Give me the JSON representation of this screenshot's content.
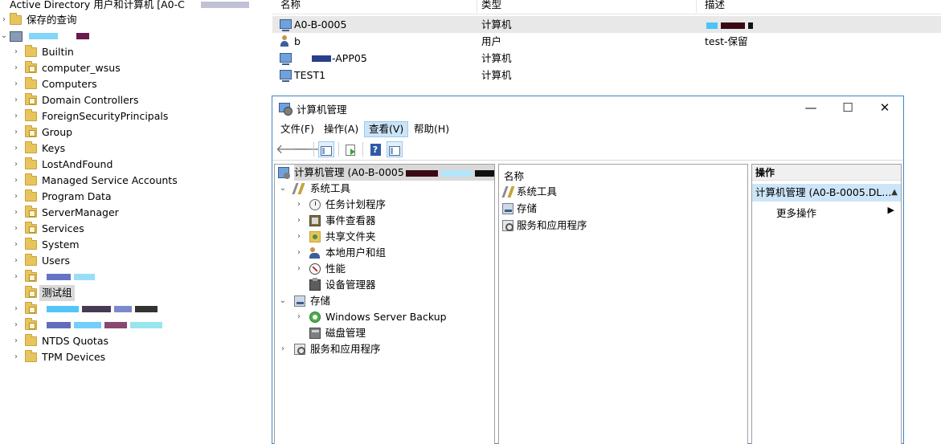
{
  "colors": {
    "window_border": "#3e85c6",
    "selection_gray": "#d9d9d9",
    "selection_row": "#e8e8e8",
    "action_highlight": "#cde5f8",
    "folder": "#e8c45c"
  },
  "ad_tree": {
    "title": "Active Directory 用户和计算机 [A0-C",
    "saved_queries": "保存的查询",
    "items": [
      {
        "label": "Builtin",
        "icon": "folder-icon"
      },
      {
        "label": "computer_wsus",
        "icon": "ou-folder-icon"
      },
      {
        "label": "Computers",
        "icon": "folder-icon"
      },
      {
        "label": "Domain Controllers",
        "icon": "ou-folder-icon"
      },
      {
        "label": "ForeignSecurityPrincipals",
        "icon": "folder-icon"
      },
      {
        "label": "Group",
        "icon": "ou-folder-icon"
      },
      {
        "label": "Keys",
        "icon": "folder-icon"
      },
      {
        "label": "LostAndFound",
        "icon": "folder-icon"
      },
      {
        "label": "Managed Service Accounts",
        "icon": "folder-icon"
      },
      {
        "label": "Program Data",
        "icon": "folder-icon"
      },
      {
        "label": "ServerManager",
        "icon": "ou-folder-icon"
      },
      {
        "label": "Services",
        "icon": "ou-folder-icon"
      },
      {
        "label": "System",
        "icon": "folder-icon"
      },
      {
        "label": "Users",
        "icon": "folder-icon"
      },
      {
        "label": "",
        "icon": "ou-folder-icon"
      },
      {
        "label": "测试组",
        "icon": "ou-folder-icon"
      },
      {
        "label": "",
        "icon": "ou-folder-icon"
      },
      {
        "label": "",
        "icon": "ou-folder-icon"
      },
      {
        "label": "NTDS Quotas",
        "icon": "folder-icon"
      },
      {
        "label": "TPM Devices",
        "icon": "folder-icon"
      }
    ]
  },
  "object_list": {
    "columns": {
      "name": "名称",
      "type": "类型",
      "description": "描述"
    },
    "rows": [
      {
        "name": "A0-B-0005",
        "type": "计算机",
        "description": "",
        "icon": "computer-icon"
      },
      {
        "name": "b",
        "type": "用户",
        "description": "test-保留",
        "icon": "user-icon"
      },
      {
        "name": "-APP05",
        "type": "计算机",
        "description": "",
        "icon": "computer-icon"
      },
      {
        "name": "TEST1",
        "type": "计算机",
        "description": "",
        "icon": "computer-icon"
      }
    ]
  },
  "cm_window": {
    "title": "计算机管理",
    "controls": {
      "minimize": "—",
      "maximize": "☐",
      "close": "✕"
    },
    "menu": [
      "文件(F)",
      "操作(A)",
      "查看(V)",
      "帮助(H)"
    ],
    "tree": {
      "root": "计算机管理 (A0-B-0005",
      "root_suffix": ".)",
      "system_tools": "系统工具",
      "task_scheduler": "任务计划程序",
      "event_viewer": "事件查看器",
      "shared_folders": "共享文件夹",
      "local_users": "本地用户和组",
      "performance": "性能",
      "device_manager": "设备管理器",
      "storage": "存储",
      "wsb": "Windows Server Backup",
      "disk_mgmt": "磁盘管理",
      "services_apps": "服务和应用程序"
    },
    "middle": {
      "header": "名称",
      "items": [
        "系统工具",
        "存储",
        "服务和应用程序"
      ]
    },
    "actions": {
      "header": "操作",
      "context": "计算机管理 (A0-B-0005.DL...",
      "more": "更多操作"
    }
  }
}
